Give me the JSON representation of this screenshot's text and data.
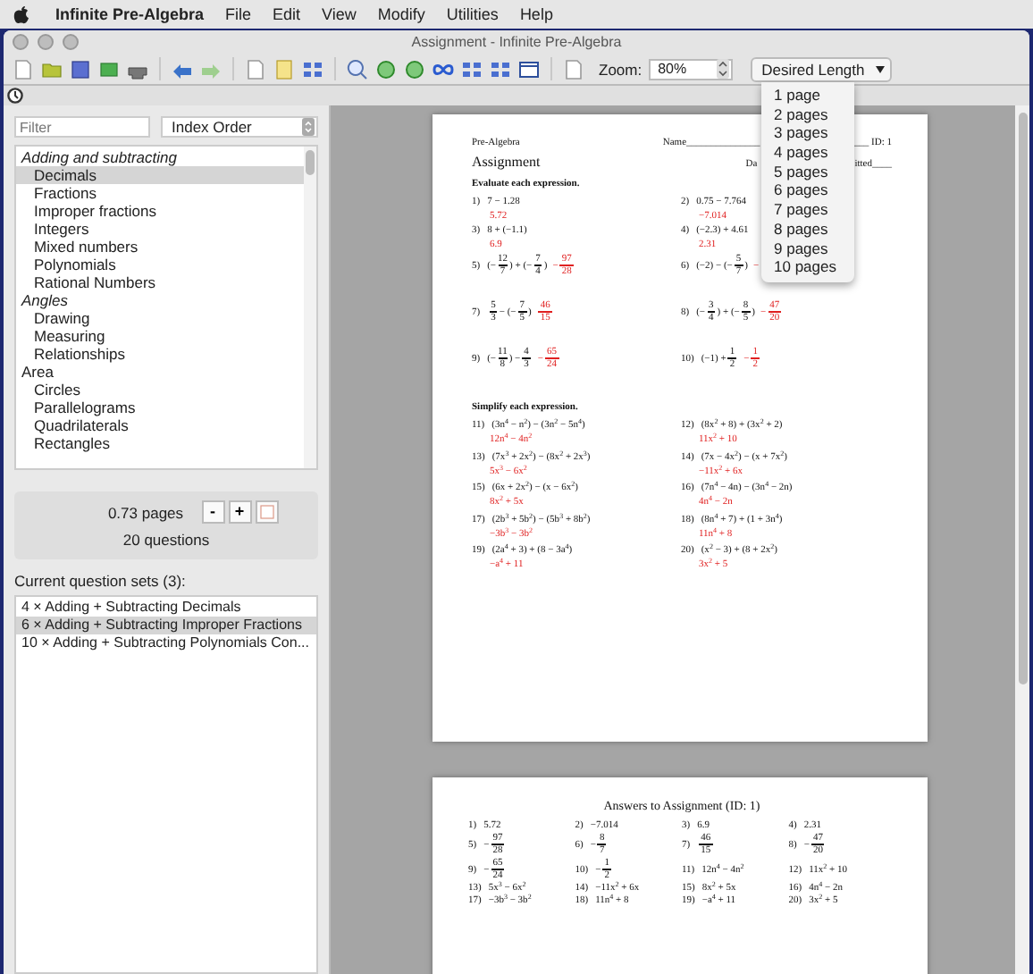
{
  "menubar": {
    "app": "Infinite Pre-Algebra",
    "items": [
      "File",
      "Edit",
      "View",
      "Modify",
      "Utilities",
      "Help"
    ]
  },
  "window": {
    "title": "Assignment - Infinite Pre-Algebra"
  },
  "toolbar": {
    "zoom_label": "Zoom:",
    "zoom_value": "80%",
    "length_popup": "Desired Length"
  },
  "length_menu": [
    "1 page",
    "2 pages",
    "3 pages",
    "4 pages",
    "5 pages",
    "6 pages",
    "7 pages",
    "8 pages",
    "9 pages",
    "10 pages"
  ],
  "sidebar": {
    "filter": {
      "placeholder": "Filter"
    },
    "sort": "Index Order",
    "topics": [
      {
        "label": "Adding and subtracting",
        "italic": true,
        "selected": false,
        "children": [
          {
            "label": "Decimals",
            "selected": true
          },
          {
            "label": "Fractions",
            "selected": false
          },
          {
            "label": "Improper fractions",
            "selected": false
          },
          {
            "label": "Integers",
            "selected": false
          },
          {
            "label": "Mixed numbers",
            "selected": false
          },
          {
            "label": "Polynomials",
            "selected": false
          },
          {
            "label": "Rational Numbers",
            "selected": false
          }
        ]
      },
      {
        "label": "Angles",
        "italic": true,
        "selected": false,
        "children": [
          {
            "label": "Drawing",
            "selected": false
          },
          {
            "label": "Measuring",
            "selected": false
          },
          {
            "label": "Relationships",
            "selected": false
          }
        ]
      },
      {
        "label": "Area",
        "italic": false,
        "selected": false,
        "children": [
          {
            "label": "Circles",
            "selected": false
          },
          {
            "label": "Parallelograms",
            "selected": false
          },
          {
            "label": "Quadrilaterals",
            "selected": false
          },
          {
            "label": "Rectangles",
            "selected": false
          }
        ]
      }
    ],
    "pages": "0.73 pages",
    "minus": "-",
    "plus": "+",
    "questions": "20 questions",
    "sets_label": "Current question sets (3):",
    "sets": [
      {
        "label": "4 × Adding + Subtracting Decimals",
        "selected": false
      },
      {
        "label": "6 × Adding + Subtracting Improper Fractions",
        "selected": true
      },
      {
        "label": "10 × Adding + Subtracting Polynomials Con...",
        "selected": false
      }
    ]
  },
  "document": {
    "subject": "Pre-Algebra",
    "name": "Name_______________",
    "id": "___ ID: 1",
    "date": "Da",
    "period": "itted____",
    "title": "Assignment",
    "sections": [
      {
        "instruction": "Evaluate each expression.",
        "problems": [
          {
            "num": "1)",
            "kind": "below",
            "expr": [
              {
                "kind": "text",
                "text": "7 − 1.28"
              }
            ],
            "answer": [
              {
                "kind": "text",
                "text": "5.72"
              }
            ]
          },
          {
            "num": "2)",
            "kind": "below",
            "expr": [
              {
                "kind": "text",
                "text": "0.75 − 7.764"
              }
            ],
            "answer": [
              {
                "kind": "text",
                "text": "−7.014"
              }
            ]
          },
          {
            "num": "3)",
            "kind": "below",
            "expr": [
              {
                "kind": "text",
                "text": "8 + (−1.1)"
              }
            ],
            "answer": [
              {
                "kind": "text",
                "text": "6.9"
              }
            ]
          },
          {
            "num": "4)",
            "kind": "below",
            "expr": [
              {
                "kind": "text",
                "text": "(−2.3) + 4.61"
              }
            ],
            "answer": [
              {
                "kind": "text",
                "text": "2.31"
              }
            ]
          },
          {
            "num": "5)",
            "kind": "inline",
            "expr": [
              {
                "kind": "text",
                "text": "(−"
              },
              {
                "kind": "frac",
                "num": "12",
                "den": "7"
              },
              {
                "kind": "text",
                "text": ") + (−"
              },
              {
                "kind": "frac",
                "num": "7",
                "den": "4"
              },
              {
                "kind": "text",
                "text": ")"
              }
            ],
            "answer": [
              {
                "kind": "text",
                "text": "−"
              },
              {
                "kind": "frac",
                "num": "97",
                "den": "28"
              }
            ]
          },
          {
            "num": "6)",
            "kind": "inline",
            "expr": [
              {
                "kind": "text",
                "text": "(−2) − (−"
              },
              {
                "kind": "frac",
                "num": "5",
                "den": "7"
              },
              {
                "kind": "text",
                "text": ")"
              }
            ],
            "answer": [
              {
                "kind": "text",
                "text": "−"
              }
            ]
          },
          {
            "num": "7)",
            "kind": "inline",
            "expr": [
              {
                "kind": "frac",
                "num": "5",
                "den": "3"
              },
              {
                "kind": "text",
                "text": " − (−"
              },
              {
                "kind": "frac",
                "num": "7",
                "den": "5"
              },
              {
                "kind": "text",
                "text": ")"
              }
            ],
            "answer": [
              {
                "kind": "frac",
                "num": "46",
                "den": "15"
              }
            ]
          },
          {
            "num": "8)",
            "kind": "inline",
            "expr": [
              {
                "kind": "text",
                "text": "(−"
              },
              {
                "kind": "frac",
                "num": "3",
                "den": "4"
              },
              {
                "kind": "text",
                "text": ") + (−"
              },
              {
                "kind": "frac",
                "num": "8",
                "den": "5"
              },
              {
                "kind": "text",
                "text": ")"
              }
            ],
            "answer": [
              {
                "kind": "text",
                "text": "−"
              },
              {
                "kind": "frac",
                "num": "47",
                "den": "20"
              }
            ]
          },
          {
            "num": "9)",
            "kind": "inline",
            "expr": [
              {
                "kind": "text",
                "text": "(−"
              },
              {
                "kind": "frac",
                "num": "11",
                "den": "8"
              },
              {
                "kind": "text",
                "text": ") − "
              },
              {
                "kind": "frac",
                "num": "4",
                "den": "3"
              }
            ],
            "answer": [
              {
                "kind": "text",
                "text": "−"
              },
              {
                "kind": "frac",
                "num": "65",
                "den": "24"
              }
            ]
          },
          {
            "num": "10)",
            "kind": "inline",
            "expr": [
              {
                "kind": "text",
                "text": "(−1) + "
              },
              {
                "kind": "frac",
                "num": "1",
                "den": "2"
              }
            ],
            "answer": [
              {
                "kind": "text",
                "text": "−"
              },
              {
                "kind": "frac",
                "num": "1",
                "den": "2"
              }
            ]
          }
        ]
      },
      {
        "instruction": "Simplify each expression.",
        "problems": [
          {
            "num": "11)",
            "kind": "below",
            "expr": [
              {
                "kind": "text",
                "text": "(3n$^{4}$ − n$^{2}$) − (3n$^{2}$ − 5n$^{4}$)"
              }
            ],
            "answer": [
              {
                "kind": "text",
                "text": "12n$^{4}$ − 4n$^{2}$"
              }
            ]
          },
          {
            "num": "12)",
            "kind": "below",
            "expr": [
              {
                "kind": "text",
                "text": "(8x$^{2}$ + 8) + (3x$^{2}$ + 2)"
              }
            ],
            "answer": [
              {
                "kind": "text",
                "text": "11x$^{2}$ + 10"
              }
            ]
          },
          {
            "num": "13)",
            "kind": "below",
            "expr": [
              {
                "kind": "text",
                "text": "(7x$^{3}$ + 2x$^{2}$) − (8x$^{2}$ + 2x$^{3}$)"
              }
            ],
            "answer": [
              {
                "kind": "text",
                "text": "5x$^{3}$ − 6x$^{2}$"
              }
            ]
          },
          {
            "num": "14)",
            "kind": "below",
            "expr": [
              {
                "kind": "text",
                "text": "(7x − 4x$^{2}$) − (x + 7x$^{2}$)"
              }
            ],
            "answer": [
              {
                "kind": "text",
                "text": "−11x$^{2}$ + 6x"
              }
            ]
          },
          {
            "num": "15)",
            "kind": "below",
            "expr": [
              {
                "kind": "text",
                "text": "(6x + 2x$^{2}$) − (x − 6x$^{2}$)"
              }
            ],
            "answer": [
              {
                "kind": "text",
                "text": "8x$^{2}$ + 5x"
              }
            ]
          },
          {
            "num": "16)",
            "kind": "below",
            "expr": [
              {
                "kind": "text",
                "text": "(7n$^{4}$ − 4n) − (3n$^{4}$ − 2n)"
              }
            ],
            "answer": [
              {
                "kind": "text",
                "text": "4n$^{4}$ − 2n"
              }
            ]
          },
          {
            "num": "17)",
            "kind": "below",
            "expr": [
              {
                "kind": "text",
                "text": "(2b$^{3}$ + 5b$^{2}$) − (5b$^{3}$ + 8b$^{2}$)"
              }
            ],
            "answer": [
              {
                "kind": "text",
                "text": "−3b$^{3}$ − 3b$^{2}$"
              }
            ]
          },
          {
            "num": "18)",
            "kind": "below",
            "expr": [
              {
                "kind": "text",
                "text": "(8n$^{4}$ + 7) + (1 + 3n$^{4}$)"
              }
            ],
            "answer": [
              {
                "kind": "text",
                "text": "11n$^{4}$ + 8"
              }
            ]
          },
          {
            "num": "19)",
            "kind": "below",
            "expr": [
              {
                "kind": "text",
                "text": "(2a$^{4}$ + 3) + (8 − 3a$^{4}$)"
              }
            ],
            "answer": [
              {
                "kind": "text",
                "text": "−a$^{4}$ + 11"
              }
            ]
          },
          {
            "num": "20)",
            "kind": "below",
            "expr": [
              {
                "kind": "text",
                "text": "(x$^{2}$ − 3) + (8 + 2x$^{2}$)"
              }
            ],
            "answer": [
              {
                "kind": "text",
                "text": "3x$^{2}$ + 5"
              }
            ]
          }
        ]
      }
    ]
  },
  "answer_key": {
    "title": "Answers to Assignment (ID: 1)",
    "answers": [
      {
        "num": "1)",
        "parts": [
          {
            "kind": "text",
            "text": "5.72"
          }
        ]
      },
      {
        "num": "2)",
        "parts": [
          {
            "kind": "text",
            "text": "−7.014"
          }
        ]
      },
      {
        "num": "3)",
        "parts": [
          {
            "kind": "text",
            "text": "6.9"
          }
        ]
      },
      {
        "num": "4)",
        "parts": [
          {
            "kind": "text",
            "text": "2.31"
          }
        ]
      },
      {
        "num": "5)",
        "parts": [
          {
            "kind": "text",
            "text": "−"
          },
          {
            "kind": "frac",
            "num": "97",
            "den": "28"
          }
        ]
      },
      {
        "num": "6)",
        "parts": [
          {
            "kind": "text",
            "text": "−"
          },
          {
            "kind": "frac",
            "num": "8",
            "den": "7"
          }
        ]
      },
      {
        "num": "7)",
        "parts": [
          {
            "kind": "frac",
            "num": "46",
            "den": "15"
          }
        ]
      },
      {
        "num": "8)",
        "parts": [
          {
            "kind": "text",
            "text": "−"
          },
          {
            "kind": "frac",
            "num": "47",
            "den": "20"
          }
        ]
      },
      {
        "num": "9)",
        "parts": [
          {
            "kind": "text",
            "text": "−"
          },
          {
            "kind": "frac",
            "num": "65",
            "den": "24"
          }
        ]
      },
      {
        "num": "10)",
        "parts": [
          {
            "kind": "text",
            "text": "−"
          },
          {
            "kind": "frac",
            "num": "1",
            "den": "2"
          }
        ]
      },
      {
        "num": "11)",
        "parts": [
          {
            "kind": "text",
            "text": "12n$^{4}$ − 4n$^{2}$"
          }
        ]
      },
      {
        "num": "12)",
        "parts": [
          {
            "kind": "text",
            "text": "11x$^{2}$ + 10"
          }
        ]
      },
      {
        "num": "13)",
        "parts": [
          {
            "kind": "text",
            "text": "5x$^{3}$ − 6x$^{2}$"
          }
        ]
      },
      {
        "num": "14)",
        "parts": [
          {
            "kind": "text",
            "text": "−11x$^{2}$ + 6x"
          }
        ]
      },
      {
        "num": "15)",
        "parts": [
          {
            "kind": "text",
            "text": "8x$^{2}$ + 5x"
          }
        ]
      },
      {
        "num": "16)",
        "parts": [
          {
            "kind": "text",
            "text": "4n$^{4}$ − 2n"
          }
        ]
      },
      {
        "num": "17)",
        "parts": [
          {
            "kind": "text",
            "text": "−3b$^{3}$ − 3b$^{2}$"
          }
        ]
      },
      {
        "num": "18)",
        "parts": [
          {
            "kind": "text",
            "text": "11n$^{4}$ + 8"
          }
        ]
      },
      {
        "num": "19)",
        "parts": [
          {
            "kind": "text",
            "text": "−a$^{4}$ + 11"
          }
        ]
      },
      {
        "num": "20)",
        "parts": [
          {
            "kind": "text",
            "text": "3x$^{2}$ + 5"
          }
        ]
      }
    ]
  }
}
